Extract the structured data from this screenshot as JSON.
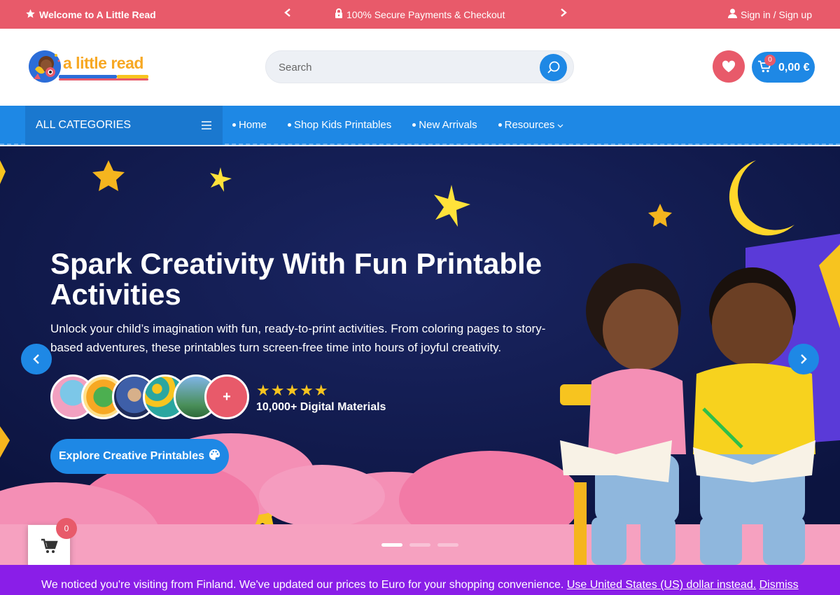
{
  "topbar": {
    "welcome": "Welcome to A Little Read",
    "promo": "100% Secure Payments & Checkout",
    "signin": "Sign in / Sign up"
  },
  "header": {
    "logo_text": "a little read",
    "search_placeholder": "Search",
    "cart_count": "0",
    "cart_total": "0,00 €"
  },
  "nav": {
    "all_categories": "ALL CATEGORIES",
    "links": [
      "Home",
      "Shop Kids Printables",
      "New Arrivals",
      "Resources"
    ]
  },
  "hero": {
    "title": "Spark Creativity With Fun Printable Activities",
    "description": "Unlock your child’s imagination with fun, ready-to-print activities. From coloring pages to story-based adventures, these printables turn screen-free time into hours of joyful creativity.",
    "plus_label": "+",
    "stars": "★★★★★",
    "rating_text": "10,000+ Digital Materials",
    "cta": "Explore Creative Printables",
    "slides": 3,
    "active_slide": 1
  },
  "floating_cart": {
    "count": "0"
  },
  "notice": {
    "message": "We noticed you're visiting from Finland. We've updated our prices to Euro for your shopping convenience.",
    "link": "Use United States (US) dollar instead.",
    "dismiss": "Dismiss"
  },
  "colors": {
    "primary_blue": "#1e88e5",
    "accent_red": "#e85a6a",
    "hero_bg": "#101a4a",
    "notice_purple": "#8a1ee8",
    "star_yellow": "#f7c41f"
  }
}
